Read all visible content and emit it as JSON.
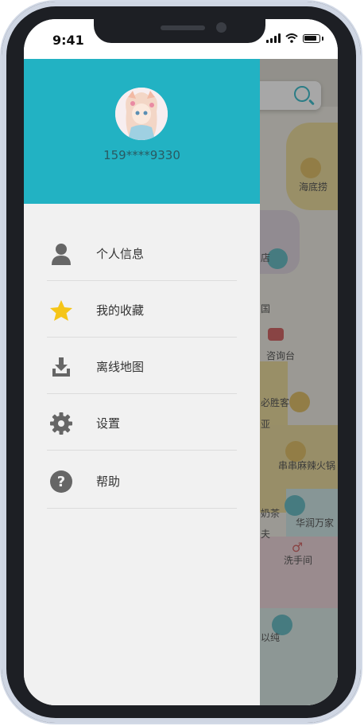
{
  "status_bar": {
    "time": "9:41"
  },
  "map": {
    "labels": [
      "海底捞",
      "店",
      "国",
      "咨询台",
      "必胜客",
      "亚",
      "串串麻辣火锅",
      "奶茶",
      "夫",
      "华润万家",
      "洗手间",
      "以纯"
    ],
    "search_icon": "search-icon"
  },
  "drawer": {
    "header_color": "#22b2c3",
    "phone": "159****9330",
    "items": [
      {
        "label": "个人信息",
        "icon": "person-icon"
      },
      {
        "label": "我的收藏",
        "icon": "star-icon"
      },
      {
        "label": "离线地图",
        "icon": "download-icon"
      },
      {
        "label": "设置",
        "icon": "gear-icon"
      },
      {
        "label": "帮助",
        "icon": "help-icon"
      }
    ]
  },
  "colors": {
    "accent": "#22b2c3",
    "star": "#f5c518",
    "icon": "#666666"
  }
}
